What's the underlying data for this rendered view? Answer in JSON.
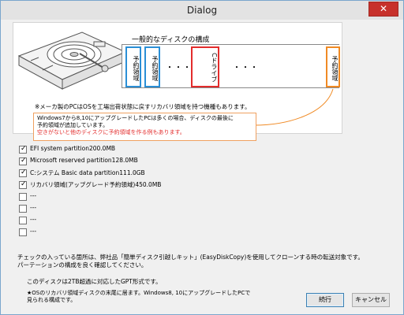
{
  "window": {
    "title": "Dialog",
    "close_glyph": "✕"
  },
  "diagram": {
    "title": "一般的なディスクの構成",
    "partitions": [
      {
        "label": "予約領域",
        "color": "#2a8fd6"
      },
      {
        "label": "予約領域",
        "color": "#2a8fd6"
      },
      {
        "label": "Cドライブ",
        "color": "#e32c2c"
      },
      {
        "label": "予約領域",
        "color": "#f08a24"
      }
    ],
    "ellipsis_1": "・・・",
    "ellipsis_2": "・・・",
    "note": "※メーカ製のPCはOSを工場出荷状態に戻すリカバリ領域を持つ機種もあります。",
    "callout_line1": "Windows7から8,10にアップグレードしたPCは多くの場合、ディスクの最後に",
    "callout_line2": "予約領域が追加しています。",
    "callout_line3": "空きがないと他のディスクに予約領域を作る例もあります。",
    "callout_highlight_color": "#e32c2c"
  },
  "partitions_list": [
    {
      "checked": true,
      "label": "EFI system partition200.0MB"
    },
    {
      "checked": true,
      "label": "Microsoft reserved partition128.0MB"
    },
    {
      "checked": true,
      "label": "C:システム  Basic data partition111.0GB"
    },
    {
      "checked": true,
      "label": "リカバリ領域(アップグレード予約領域)450.0MB"
    },
    {
      "checked": false,
      "label": "---"
    },
    {
      "checked": false,
      "label": "---"
    },
    {
      "checked": false,
      "label": "---"
    },
    {
      "checked": false,
      "label": "---"
    }
  ],
  "description": {
    "line1": "チェックの入っている箇所は、弊社品「簡単ディスク引越しキット」(EasyDiskCopy)を使用してクローンする時の転送対象です。",
    "line2": "パーテーションの構成を良く確認してください。",
    "line3": "このディスクは2TB超過に対応したGPT形式です。",
    "line4": "★OSのリカバリ領域ディスクの末尾に居ます。Windows8, 10にアップグレードしたPCで",
    "line5": "見られる構成です。"
  },
  "buttons": {
    "ok": "続行",
    "cancel": "キャンセル"
  }
}
